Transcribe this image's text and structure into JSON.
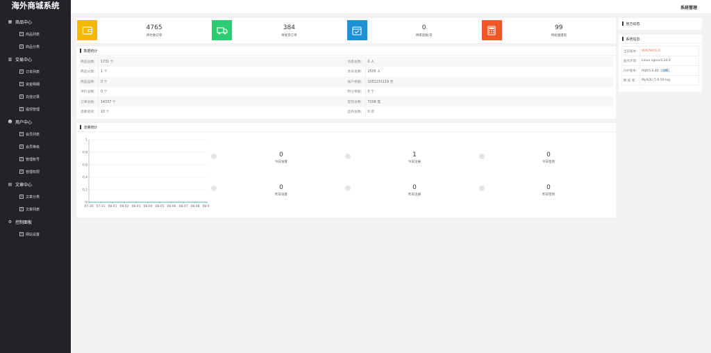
{
  "app": {
    "title": "海外商城系统",
    "system_menu": "系统管理"
  },
  "sidebar": {
    "groups": [
      {
        "title": "商品中心",
        "icon": "grid-icon",
        "items": [
          "商品列表",
          "商品分类"
        ]
      },
      {
        "title": "交易中心",
        "icon": "bar-chart-icon",
        "items": [
          "订单列表",
          "资金明细",
          "充值记录",
          "提现管理"
        ]
      },
      {
        "title": "用户中心",
        "icon": "user-icon",
        "items": [
          "会员列表",
          "会员等级",
          "管理帐号",
          "管理权限"
        ]
      },
      {
        "title": "文章中心",
        "icon": "document-icon",
        "items": [
          "文章分类",
          "文章列表"
        ]
      },
      {
        "title": "控制面板",
        "icon": "gear-icon",
        "items": [
          "网站设置"
        ]
      }
    ]
  },
  "stats": [
    {
      "value": "4765",
      "label": "待付款订单",
      "color": "#f5b800",
      "icon": "wallet-icon"
    },
    {
      "value": "384",
      "label": "待发货订单",
      "color": "#2ecc71",
      "icon": "truck-icon"
    },
    {
      "value": "0",
      "label": "待审退款/货",
      "color": "#1e90d6",
      "icon": "calendar-check-icon"
    },
    {
      "value": "99",
      "label": "待处理提现",
      "color": "#f0582a",
      "icon": "calculator-icon"
    }
  ],
  "data_stats": {
    "title": "数据统计",
    "rows": [
      [
        {
          "k": "商品总数:",
          "v": "1731 个"
        },
        {
          "k": "访客总数:",
          "v": "0 人"
        }
      ],
      [
        {
          "k": "商品分类:",
          "v": "1 个"
        },
        {
          "k": "会员总数:",
          "v": "2505 人"
        }
      ],
      [
        {
          "k": "商品品牌:",
          "v": "0 个"
        },
        {
          "k": "账户余额:",
          "v": "1051231119 元"
        }
      ],
      [
        {
          "k": "评价总数:",
          "v": "0 个"
        },
        {
          "k": "积分余额:",
          "v": "0 个"
        }
      ],
      [
        {
          "k": "订单总数:",
          "v": "14337 个"
        },
        {
          "k": "提现总数:",
          "v": "7208 笔"
        }
      ],
      [
        {
          "k": "退款退货:",
          "v": "10 个"
        },
        {
          "k": "签到总数:",
          "v": "0 次"
        }
      ]
    ]
  },
  "traffic": {
    "title": "流量统计",
    "metrics": [
      {
        "value": "0",
        "label": "今日访客"
      },
      {
        "value": "1",
        "label": "今日注册"
      },
      {
        "value": "0",
        "label": "今日签到"
      },
      {
        "value": "0",
        "label": "昨日访客"
      },
      {
        "value": "0",
        "label": "昨日注册"
      },
      {
        "value": "0",
        "label": "昨日签到"
      }
    ]
  },
  "chart_data": {
    "type": "line",
    "x": [
      "07-30",
      "07-31",
      "08-01",
      "08-02",
      "08-03",
      "08-04",
      "08-05",
      "08-06",
      "08-07",
      "08-08",
      "08-09"
    ],
    "series": [
      {
        "values": [
          0,
          0,
          0,
          0,
          0,
          0,
          0,
          0,
          0,
          0,
          0
        ]
      }
    ],
    "yticks": [
      "0",
      "0.2",
      "0.4",
      "0.6",
      "0.8",
      "1"
    ],
    "ylim": [
      0,
      1
    ],
    "grid": true,
    "line_color": "#2aa8a0"
  },
  "news": {
    "title": "官方动态"
  },
  "sysinfo": {
    "title": "系统信息",
    "rows": [
      {
        "k": "当前版本:",
        "v": "XIAOYAO1.0",
        "style": "orange"
      },
      {
        "k": "服务环境:",
        "v": "Linux nginx/1.24.0",
        "style": ""
      },
      {
        "k": "PHP版本:",
        "v": "PHP/5.6.40",
        "extra": "[详细]",
        "style": ""
      },
      {
        "k": "数 据 库:",
        "v": "MySQLi 5.6.50-log",
        "style": ""
      }
    ]
  }
}
